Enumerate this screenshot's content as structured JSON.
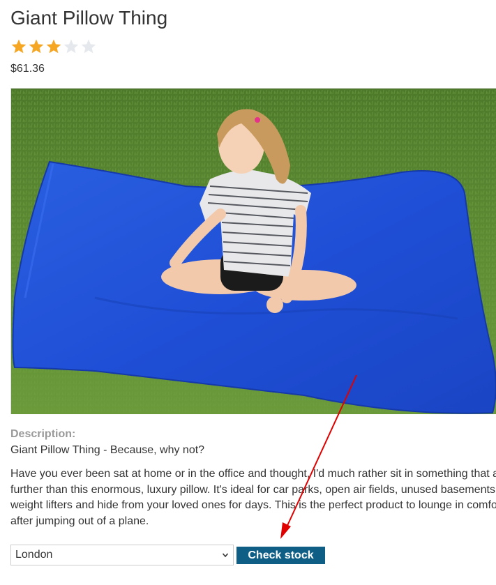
{
  "product": {
    "title": "Giant Pillow Thing",
    "rating": 3,
    "rating_max": 5,
    "price": "$61.36"
  },
  "description": {
    "label": "Description:",
    "tagline": "Giant Pillow Thing - Because, why not?",
    "lines": [
      "Have you ever been sat at home or in the office and thought, I'd much rather sit in something that a",
      "further than this enormous, luxury pillow. It's ideal for car parks, open air fields, unused basements",
      "weight lifters and hide from your loved ones for days. This is the perfect product to lounge in comfo",
      "after jumping out of a plane."
    ]
  },
  "stock": {
    "selected_store": "London",
    "button_label": "Check stock"
  },
  "colors": {
    "star_filled": "#f5a623",
    "star_empty": "#e5e8ec",
    "button_bg": "#0f5e86",
    "annotation_arrow": "#e00000"
  },
  "icons": {
    "dropdown": "chevron-down-icon",
    "rating": "star-icon",
    "annotation": "arrow-icon"
  }
}
